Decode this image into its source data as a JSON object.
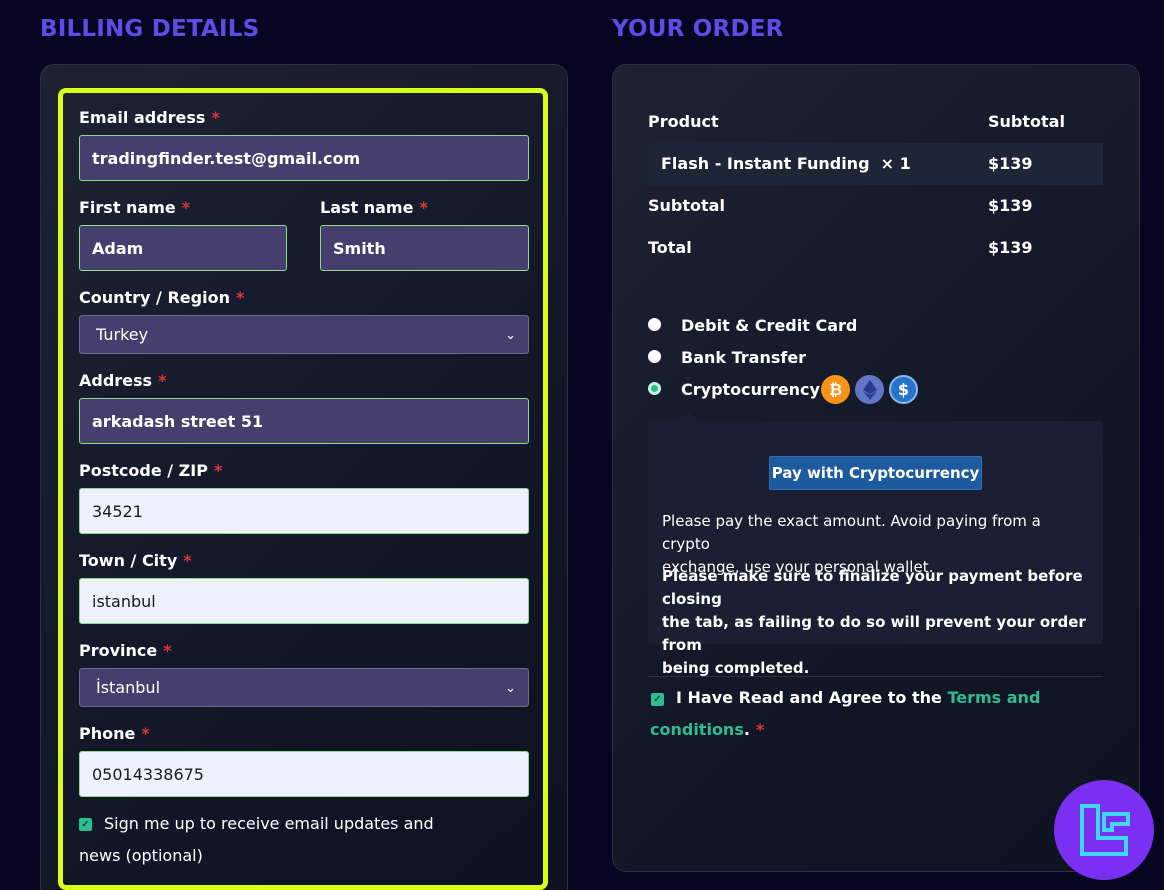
{
  "billing": {
    "title": "BILLING DETAILS",
    "required_mark": "*",
    "email": {
      "label": "Email address",
      "value": "tradingfinder.test@gmail.com"
    },
    "first_name": {
      "label": "First name",
      "value": "Adam"
    },
    "last_name": {
      "label": "Last name",
      "value": "Smith"
    },
    "country": {
      "label": "Country / Region",
      "value": "Turkey"
    },
    "address": {
      "label": "Address",
      "value": "arkadash street 51"
    },
    "postcode": {
      "label": "Postcode / ZIP",
      "value": "34521"
    },
    "city": {
      "label": "Town / City",
      "value": "istanbul"
    },
    "province": {
      "label": "Province",
      "value": "İstanbul"
    },
    "phone": {
      "label": "Phone",
      "value": "05014338675"
    },
    "newsletter": {
      "line1": "Sign me up to receive email updates and",
      "line2": "news (optional)",
      "checked": true
    }
  },
  "order": {
    "title": "YOUR ORDER",
    "col_product": "Product",
    "col_subtotal": "Subtotal",
    "item": {
      "name": "Flash - Instant Funding",
      "qty": "× 1",
      "price": "$139"
    },
    "subtotal": {
      "label": "Subtotal",
      "value": "$139"
    },
    "total": {
      "label": "Total",
      "value": "$139"
    },
    "payment_methods": [
      {
        "label": "Debit & Credit Card",
        "selected": false
      },
      {
        "label": "Bank Transfer",
        "selected": false
      },
      {
        "label": "Cryptocurrency",
        "selected": true
      }
    ],
    "coins": [
      "bitcoin-icon",
      "ethereum-icon",
      "usdc-icon"
    ],
    "pay_button": "Pay with Cryptocurrency",
    "note1_l1": "Please pay the exact amount. Avoid paying from a crypto",
    "note1_l2": "exchange, use your personal wallet.",
    "note2_l1": "Please make sure to finalize your payment before closing",
    "note2_l2": "the tab, as failing to do so will prevent your order from",
    "note2_l3": "being completed.",
    "terms_text": "I Have Read and Agree to the",
    "terms_link_1": "Terms and",
    "terms_link_2": "conditions",
    "terms_period": "."
  },
  "colors": {
    "accent": "#5b4de6",
    "highlight": "#d7ff1a",
    "green": "#2ebd93",
    "logo": "#7b2ff2"
  }
}
